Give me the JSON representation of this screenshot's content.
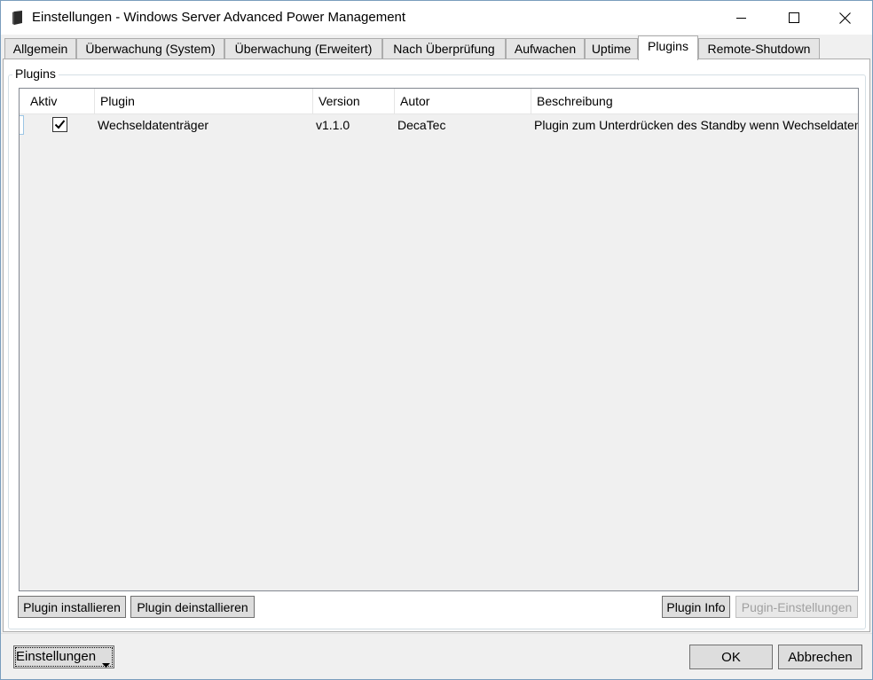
{
  "window": {
    "title": "Einstellungen - Windows Server Advanced Power Management"
  },
  "tabs": [
    {
      "label": "Allgemein",
      "active": false
    },
    {
      "label": "Überwachung (System)",
      "active": false
    },
    {
      "label": "Überwachung (Erweitert)",
      "active": false
    },
    {
      "label": "Nach Überprüfung",
      "active": false
    },
    {
      "label": "Aufwachen",
      "active": false
    },
    {
      "label": "Uptime",
      "active": false
    },
    {
      "label": "Plugins",
      "active": true
    },
    {
      "label": "Remote-Shutdown",
      "active": false
    }
  ],
  "plugins_group": {
    "label": "Plugins",
    "columns": [
      "Aktiv",
      "Plugin",
      "Version",
      "Autor",
      "Beschreibung"
    ],
    "rows": [
      {
        "active": true,
        "plugin": "Wechseldatenträger",
        "version": "v1.1.0",
        "author": "DecaTec",
        "description": "Plugin zum Unterdrücken des Standby wenn Wechseldatenträger angeschlossen sind"
      }
    ],
    "buttons": {
      "install": "Plugin installieren",
      "uninstall": "Plugin deinstallieren",
      "info": "Plugin Info",
      "settings": "Pugin-Einstellungen"
    }
  },
  "footer": {
    "settings_dropdown": "Einstellungen",
    "ok": "OK",
    "cancel": "Abbrechen"
  },
  "icons": {
    "app": "server-icon",
    "minimize": "minimize-icon",
    "maximize": "maximize-icon",
    "close": "close-icon",
    "checkbox": "checkmark-icon",
    "dropdown": "caret-down-icon"
  }
}
